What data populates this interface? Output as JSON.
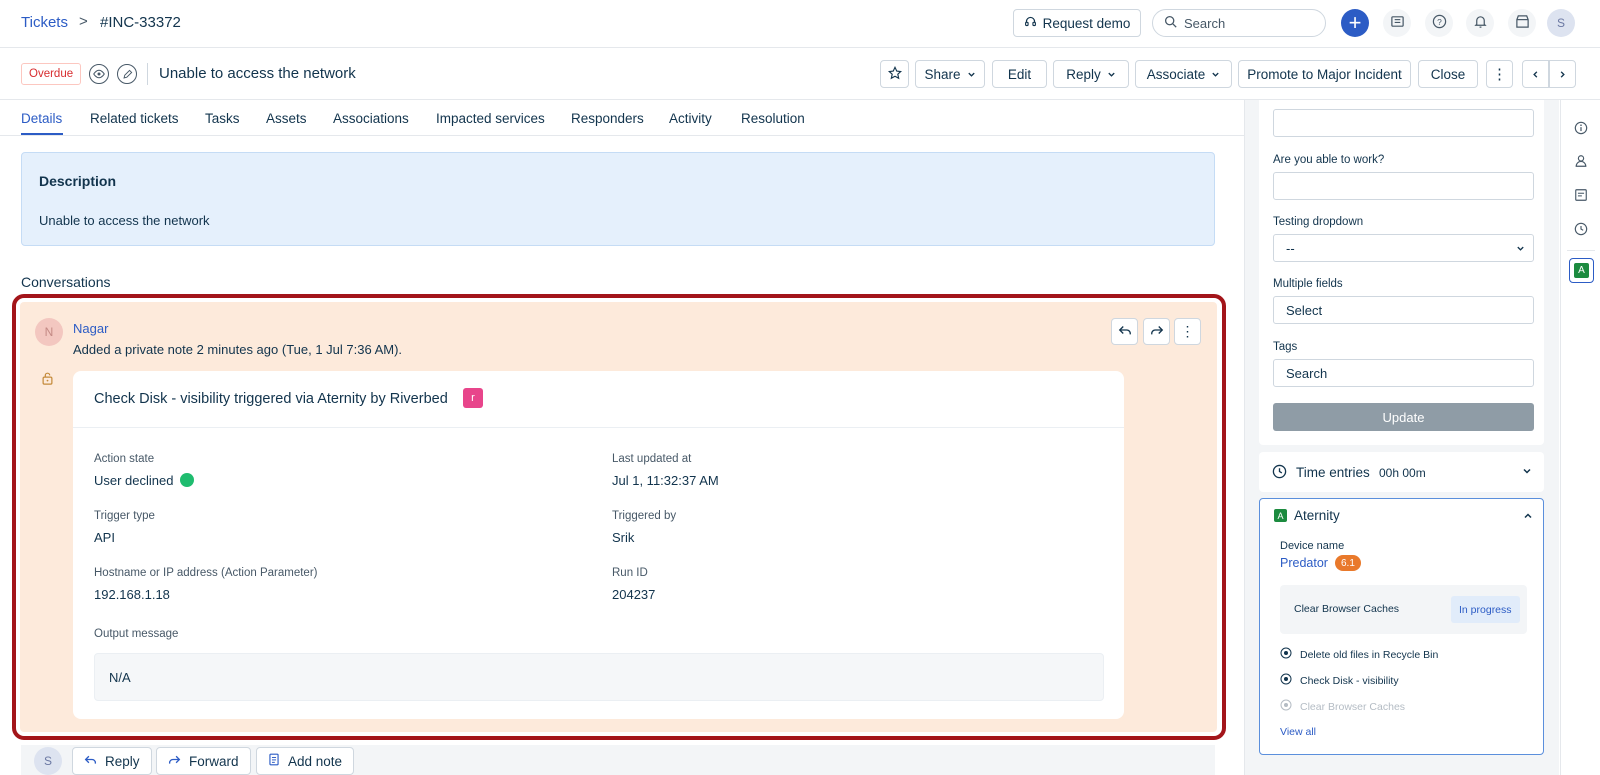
{
  "breadcrumb": {
    "root": "Tickets",
    "separator": ">",
    "ticket_id": "#INC-33372"
  },
  "header": {
    "request_demo": "Request demo",
    "search_placeholder": "Search",
    "user_initial": "S"
  },
  "ticket": {
    "status_badge": "Overdue",
    "subject": "Unable to access the network",
    "actions": {
      "share": "Share",
      "edit": "Edit",
      "reply": "Reply",
      "associate": "Associate",
      "promote": "Promote to Major Incident",
      "close": "Close"
    }
  },
  "tabs": [
    "Details",
    "Related tickets",
    "Tasks",
    "Assets",
    "Associations",
    "Impacted services",
    "Responders",
    "Activity",
    "Resolution"
  ],
  "description": {
    "title": "Description",
    "body": "Unable to access the network"
  },
  "conversations": {
    "title": "Conversations",
    "note": {
      "avatar": "N",
      "author": "Nagar",
      "meta": "Added a private note 2 minutes ago (Tue, 1 Jul 7:36 AM).",
      "card": {
        "title": "Check Disk - visibility triggered via Aternity by Riverbed",
        "badge": "r",
        "fields": {
          "action_state_label": "Action state",
          "action_state": "User declined",
          "last_updated_label": "Last updated at",
          "last_updated": "Jul 1, 11:32:37 AM",
          "trigger_type_label": "Trigger type",
          "trigger_type": "API",
          "triggered_by_label": "Triggered by",
          "triggered_by": "Srik",
          "hostname_label": "Hostname or IP address (Action Parameter)",
          "hostname": "192.168.1.18",
          "run_id_label": "Run ID",
          "run_id": "204237",
          "output_label": "Output message",
          "output": "N/A"
        }
      }
    }
  },
  "reply_bar": {
    "avatar": "S",
    "reply": "Reply",
    "forward": "Forward",
    "add_note": "Add note"
  },
  "sidebar": {
    "able_to_work_label": "Are you able to work?",
    "testing_dropdown_label": "Testing dropdown",
    "testing_dropdown_value": "--",
    "multiple_fields_label": "Multiple fields",
    "multiple_fields_value": "Select",
    "tags_label": "Tags",
    "tags_placeholder": "Search",
    "update": "Update",
    "time_entries_label": "Time entries",
    "time_entries_value": "00h 00m",
    "aternity": {
      "title": "Aternity",
      "app_badge": "A",
      "device_name_label": "Device name",
      "device_name": "Predator",
      "score": "6.1",
      "current_action": "Clear Browser Caches",
      "current_status": "In progress",
      "actions": [
        "Delete old files in Recycle Bin",
        "Check Disk - visibility",
        "Clear Browser Caches"
      ],
      "view_all": "View all"
    }
  },
  "colors": {
    "brand": "#2c5cc5",
    "overdue": "#d72d30",
    "note_bg": "#fdeadb",
    "highlight": "#a3151a",
    "success": "#1fbc6f",
    "badge_pink": "#e8458b",
    "score_orange": "#e9792b"
  }
}
